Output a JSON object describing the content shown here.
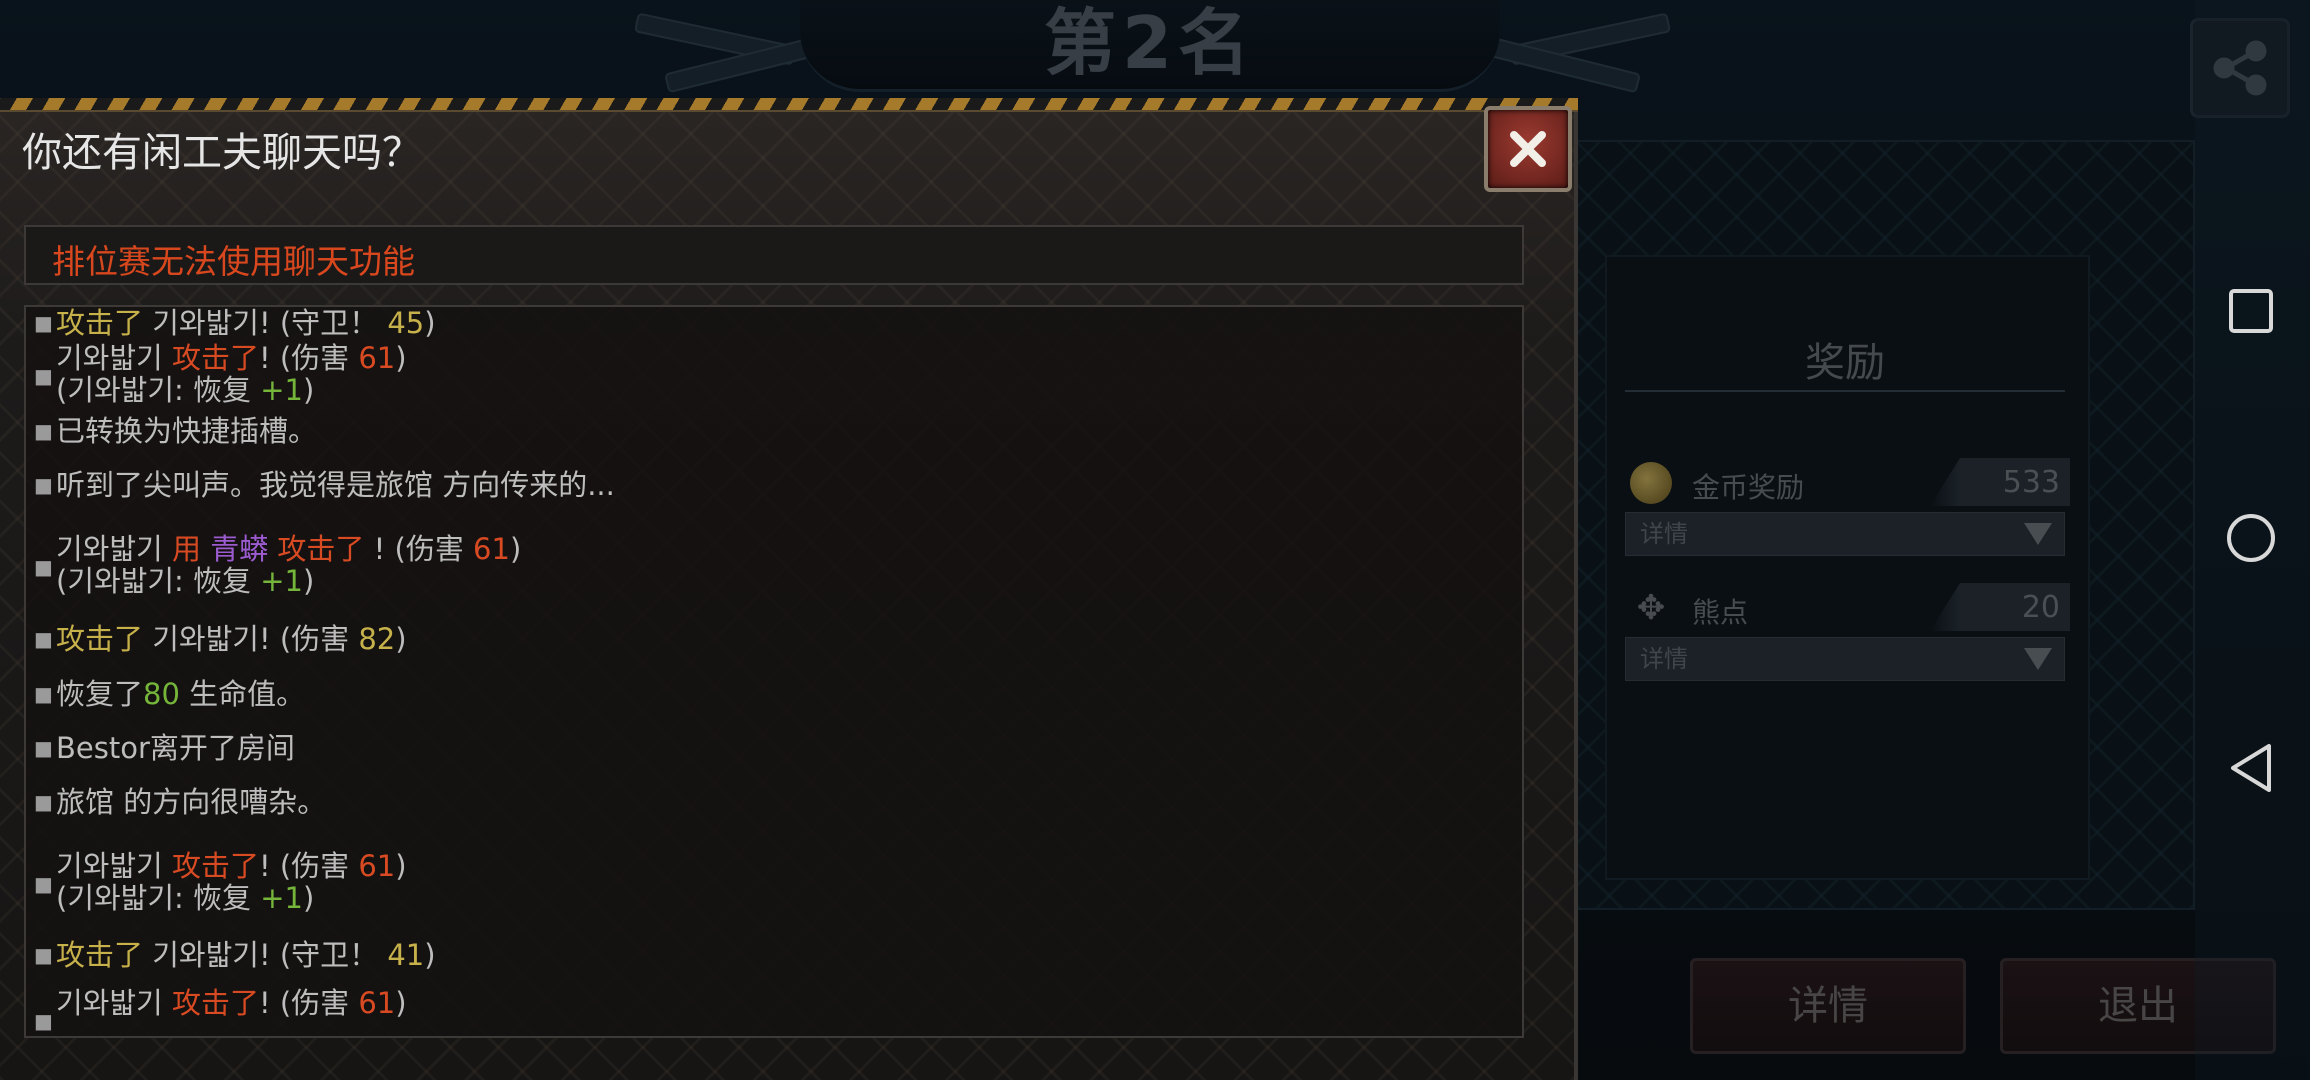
{
  "header": {
    "rank_title": "第2名"
  },
  "reward": {
    "title": "奖励",
    "rows": [
      {
        "icon": "coin-icon",
        "label": "金币奖励",
        "value": "533",
        "detail": "详情"
      },
      {
        "icon": "bear-paw-icon",
        "label": "熊点",
        "value": "20",
        "detail": "详情"
      }
    ]
  },
  "buttons": {
    "details": "详情",
    "exit": "退出"
  },
  "dialog": {
    "title": "你还有闲工夫聊天吗？",
    "notice": "排位赛无法使用聊天功能",
    "log": {
      "e1": {
        "a": "攻击了",
        "b": "기와밟기",
        "c": "! (守卫！",
        "d": "45",
        "e": ")"
      },
      "e2": {
        "a": "기와밟기",
        "b": "攻击了",
        "c": "! (伤害",
        "d": "61",
        "e": ")",
        "f": "(기와밟기: 恢复",
        "g": "+1",
        "h": ")"
      },
      "e3": {
        "a": "已转换为快捷插槽。"
      },
      "e4": {
        "a": "听到了尖叫声。我觉得是旅馆 方向传来的..."
      },
      "e5": {
        "a": "기와밟기",
        "b": "用",
        "c": "青蟒",
        "d": "攻击了",
        "e": "! (伤害",
        "f": "61",
        "g": ")",
        "h": "(기와밟기: 恢复",
        "i": "+1",
        "j": ")"
      },
      "e6": {
        "a": "攻击了",
        "b": "기와밟기",
        "c": "! (伤害",
        "d": "82",
        "e": ")"
      },
      "e7": {
        "a": "恢复了",
        "b": "80",
        "c": "生命值。"
      },
      "e8": {
        "a": "Bestor离开了房间"
      },
      "e9": {
        "a": "旅馆 的方向很嘈杂。"
      },
      "e10": {
        "a": "기와밟기",
        "b": "攻击了",
        "c": "! (伤害",
        "d": "61",
        "e": ")",
        "f": "(기와밟기: 恢复",
        "g": "+1",
        "h": ")"
      },
      "e11": {
        "a": "攻击了",
        "b": "기와밟기",
        "c": "! (守卫！",
        "d": "41",
        "e": ")"
      },
      "e12": {
        "a": "기와밟기",
        "b": "攻击了",
        "c": "! (伤害",
        "d": "61",
        "e": ")"
      }
    }
  },
  "colors": {
    "damage": "#d84a22",
    "highlight": "#c7b14a",
    "heal": "#74b53a",
    "weapon": "#9c5bd0"
  }
}
